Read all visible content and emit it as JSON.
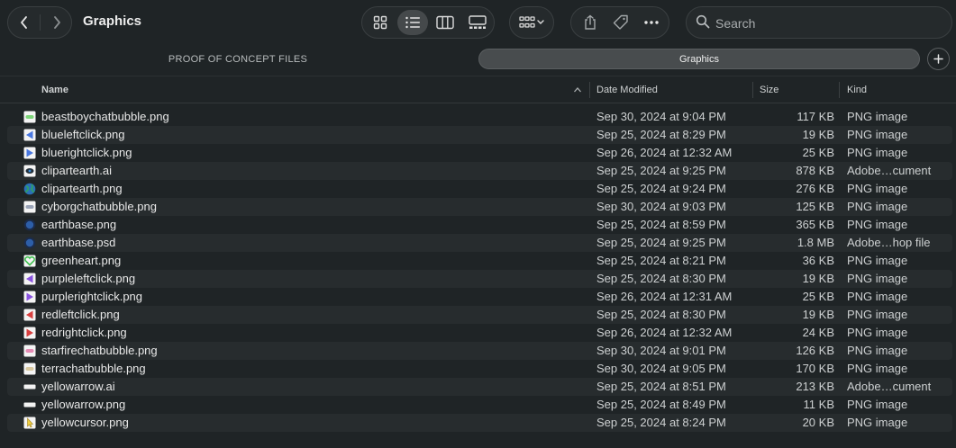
{
  "window": {
    "title": "Graphics"
  },
  "toolbar": {
    "back_icon": "chevron-left-icon",
    "forward_icon": "chevron-right-icon",
    "view_modes": [
      "icon-view",
      "list-view",
      "column-view",
      "gallery-view"
    ],
    "active_view": "list-view",
    "group_icon": "group-by-icon",
    "share_icon": "share-icon",
    "tag_icon": "tag-icon",
    "more_icon": "ellipsis-icon"
  },
  "search": {
    "placeholder": "Search",
    "value": ""
  },
  "tabs": [
    {
      "label": "PROOF OF CONCEPT FILES",
      "active": false
    },
    {
      "label": "Graphics",
      "active": true
    }
  ],
  "columns": {
    "name": "Name",
    "date": "Date Modified",
    "size": "Size",
    "kind": "Kind",
    "sort_indicator": "^"
  },
  "files": [
    {
      "name": "beastboychatbubble.png",
      "date": "Sep 30, 2024 at 9:04 PM",
      "size": "117 KB",
      "kind": "PNG image",
      "icon": "bubble",
      "color": "#7ed67a"
    },
    {
      "name": "blueleftclick.png",
      "date": "Sep 25, 2024 at 8:29 PM",
      "size": "19 KB",
      "kind": "PNG image",
      "icon": "tri-left",
      "color": "#4a78e0"
    },
    {
      "name": "bluerightclick.png",
      "date": "Sep 26, 2024 at 12:32 AM",
      "size": "25 KB",
      "kind": "PNG image",
      "icon": "tri-right",
      "color": "#4a78e0"
    },
    {
      "name": "clipartearth.ai",
      "date": "Sep 25, 2024 at 9:25 PM",
      "size": "878 KB",
      "kind": "Adobe…cument",
      "icon": "ai",
      "color": "#3b8bd6"
    },
    {
      "name": "clipartearth.png",
      "date": "Sep 25, 2024 at 9:24 PM",
      "size": "276 KB",
      "kind": "PNG image",
      "icon": "globe",
      "color": "#2f9b6a"
    },
    {
      "name": "cyborgchatbubble.png",
      "date": "Sep 30, 2024 at 9:03 PM",
      "size": "125 KB",
      "kind": "PNG image",
      "icon": "bubble",
      "color": "#9aa4b8"
    },
    {
      "name": "earthbase.png",
      "date": "Sep 25, 2024 at 8:59 PM",
      "size": "365 KB",
      "kind": "PNG image",
      "icon": "disc",
      "color": "#2d5ea8"
    },
    {
      "name": "earthbase.psd",
      "date": "Sep 25, 2024 at 9:25 PM",
      "size": "1.8 MB",
      "kind": "Adobe…hop file",
      "icon": "disc",
      "color": "#2d5ea8"
    },
    {
      "name": "greenheart.png",
      "date": "Sep 25, 2024 at 8:21 PM",
      "size": "36 KB",
      "kind": "PNG image",
      "icon": "heart",
      "color": "#3fbf4f"
    },
    {
      "name": "purpleleftclick.png",
      "date": "Sep 25, 2024 at 8:30 PM",
      "size": "19 KB",
      "kind": "PNG image",
      "icon": "tri-left",
      "color": "#8a54e0"
    },
    {
      "name": "purplerightclick.png",
      "date": "Sep 26, 2024 at 12:31 AM",
      "size": "25 KB",
      "kind": "PNG image",
      "icon": "tri-right",
      "color": "#8a54e0"
    },
    {
      "name": "redleftclick.png",
      "date": "Sep 25, 2024 at 8:30 PM",
      "size": "19 KB",
      "kind": "PNG image",
      "icon": "tri-left",
      "color": "#d94040"
    },
    {
      "name": "redrightclick.png",
      "date": "Sep 26, 2024 at 12:32 AM",
      "size": "24 KB",
      "kind": "PNG image",
      "icon": "tri-right",
      "color": "#d94040"
    },
    {
      "name": "starfirechatbubble.png",
      "date": "Sep 30, 2024 at 9:01 PM",
      "size": "126 KB",
      "kind": "PNG image",
      "icon": "bubble",
      "color": "#e58bb4"
    },
    {
      "name": "terrachatbubble.png",
      "date": "Sep 30, 2024 at 9:05 PM",
      "size": "170 KB",
      "kind": "PNG image",
      "icon": "bubble",
      "color": "#d9c9a0"
    },
    {
      "name": "yellowarrow.ai",
      "date": "Sep 25, 2024 at 8:51 PM",
      "size": "213 KB",
      "kind": "Adobe…cument",
      "icon": "bar",
      "color": "#f2f2f2"
    },
    {
      "name": "yellowarrow.png",
      "date": "Sep 25, 2024 at 8:49 PM",
      "size": "11 KB",
      "kind": "PNG image",
      "icon": "bar",
      "color": "#f2f2f2"
    },
    {
      "name": "yellowcursor.png",
      "date": "Sep 25, 2024 at 8:24 PM",
      "size": "20 KB",
      "kind": "PNG image",
      "icon": "cursor",
      "color": "#f0d040"
    }
  ]
}
